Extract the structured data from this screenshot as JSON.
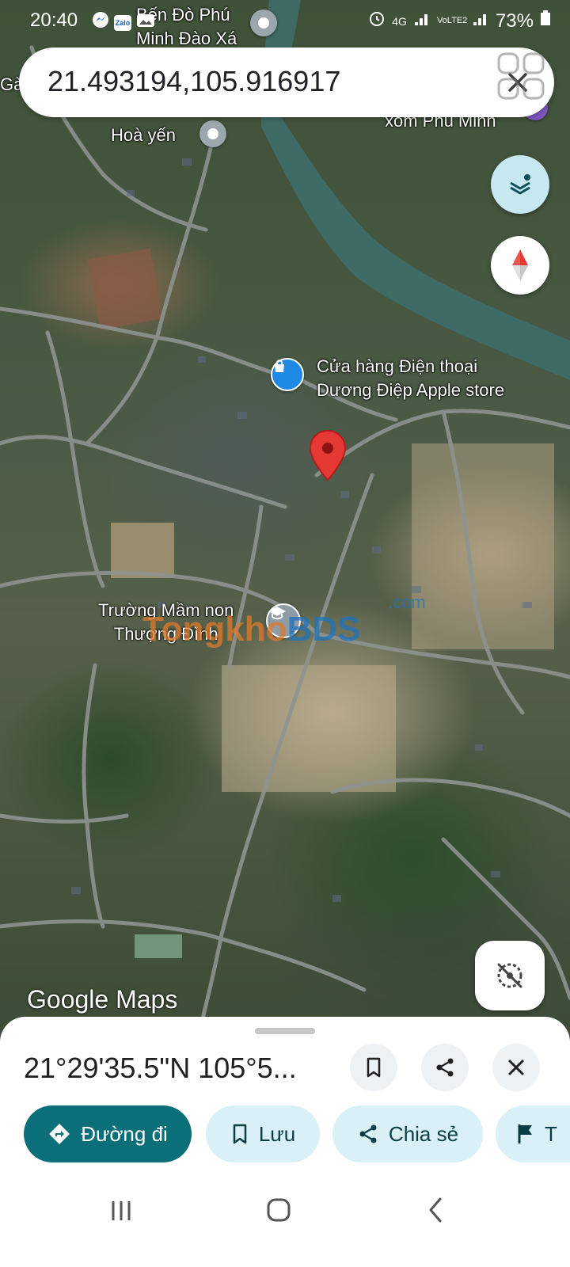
{
  "status_bar": {
    "time": "20:40",
    "network": "4G",
    "network_sub": "VoLTE2",
    "battery": "73%"
  },
  "search": {
    "query": "21.493194,105.916917"
  },
  "map": {
    "labels": {
      "ben_do_line1": "Bến Đò Phú",
      "ben_do_line2": "Minh Đào Xá",
      "hoa_yen": "Hoà yến",
      "xom_phu_minh": "xóm Phú Minh",
      "store_line1": "Cửa hàng Điện thoại",
      "store_line2": "Dương Điệp Apple store",
      "school_line1": "Trường Mầm non",
      "school_line2": "Thượng Đình",
      "left_edge": "Gà"
    },
    "watermark": {
      "text_a": "Tongkho",
      "text_b": "BDS",
      "text_c": ".com"
    },
    "brand": "Google Maps",
    "pin_color": "#e53935"
  },
  "sheet": {
    "coordinates": "21°29'35.5\"N 105°5...",
    "chips": {
      "directions": "Đường đi",
      "save": "Lưu",
      "share": "Chia sẻ",
      "more": "T"
    }
  },
  "colors": {
    "accent": "#0b6f7a",
    "chip_bg": "#d9f1f6",
    "fab_layers_bg": "#c7e8f0"
  }
}
